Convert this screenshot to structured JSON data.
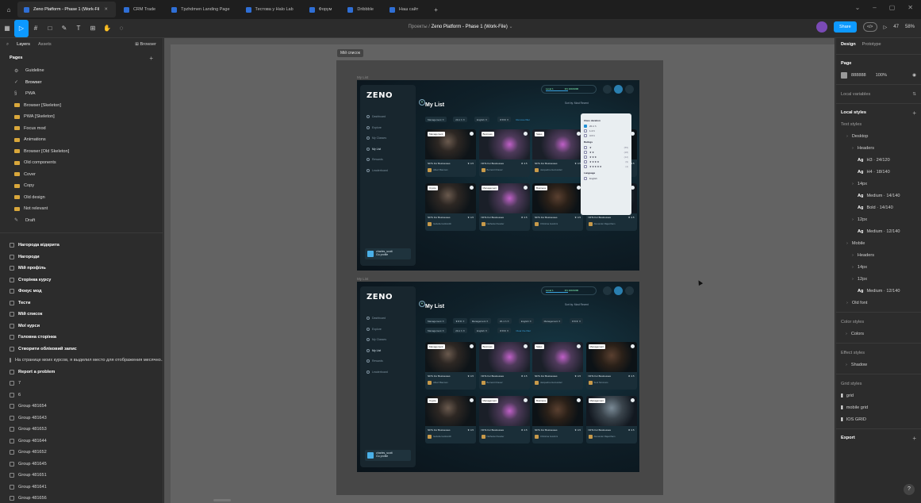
{
  "tabs": [
    {
      "label": "Zeno Platform - Phase 1 (Work-Fil",
      "active": true
    },
    {
      "label": "CRM Trade",
      "active": false
    },
    {
      "label": "Tpzhdmen Landing Page",
      "active": false
    },
    {
      "label": "Тестова у Halo Lab",
      "active": false
    },
    {
      "label": "Форум",
      "active": false
    },
    {
      "label": "Dribbble",
      "active": false
    },
    {
      "label": "Наш сайт",
      "active": false
    }
  ],
  "toolbar": {
    "breadcrumb_parent": "Проекты",
    "breadcrumb_sep": "/",
    "breadcrumb_file": "Zeno Platform - Phase 1 (Work-File)",
    "share_label": "Share",
    "zoom": "58%",
    "dev_mode": "</>",
    "play_label": "▷",
    "user_label": "47"
  },
  "left": {
    "tab_layers": "Layers",
    "tab_assets": "Assets",
    "browse_label": "Browser",
    "pages_heading": "Pages",
    "pages": [
      {
        "label": "Guideline",
        "type": "gear"
      },
      {
        "label": "Browser",
        "type": "check"
      },
      {
        "label": "PWA",
        "type": "plain"
      },
      {
        "label": "Browser [Skeleton]",
        "type": "folder"
      },
      {
        "label": "PWA [Skeleton]",
        "type": "folder"
      },
      {
        "label": "Focus mod",
        "type": "folder"
      },
      {
        "label": "Animations",
        "type": "folder"
      },
      {
        "label": "Browser [Old Skeleton]",
        "type": "folder"
      },
      {
        "label": "Old components",
        "type": "folder"
      },
      {
        "label": "Cover",
        "type": "folder"
      },
      {
        "label": "Copy",
        "type": "folder"
      },
      {
        "label": "Old design",
        "type": "folder"
      },
      {
        "label": "Not relevant",
        "type": "folder"
      },
      {
        "label": "Draft",
        "type": "draft"
      }
    ],
    "layers": [
      {
        "label": "Нагорода відкрита",
        "bold": true
      },
      {
        "label": "Нагороди",
        "bold": true
      },
      {
        "label": "Мій профіль",
        "bold": true
      },
      {
        "label": "Сторінка курсу",
        "bold": true
      },
      {
        "label": "Фокус мод",
        "bold": true
      },
      {
        "label": "Тести",
        "bold": true
      },
      {
        "label": "Мій список",
        "bold": true
      },
      {
        "label": "Мої курси",
        "bold": true
      },
      {
        "label": "Головна сторінка",
        "bold": true
      },
      {
        "label": "Створити обліковий запис",
        "bold": true
      },
      {
        "label": "На странице моих курсов, я выделил место для отображения месячно...",
        "bold": false
      },
      {
        "label": "Report a problem",
        "bold": true
      },
      {
        "label": "7",
        "bold": false
      },
      {
        "label": "6",
        "bold": false
      },
      {
        "label": "Group 481654",
        "bold": false
      },
      {
        "label": "Group 481643",
        "bold": false
      },
      {
        "label": "Group 481653",
        "bold": false
      },
      {
        "label": "Group 481644",
        "bold": false
      },
      {
        "label": "Group 481652",
        "bold": false
      },
      {
        "label": "Group 481645",
        "bold": false
      },
      {
        "label": "Group 481651",
        "bold": false
      },
      {
        "label": "Group 481641",
        "bold": false
      },
      {
        "label": "Group 481656",
        "bold": false
      }
    ]
  },
  "canvas": {
    "frame_label": "Мій список",
    "section_label": "My List",
    "app": {
      "logo": "ZENO",
      "page_title": "My List",
      "nav": [
        "Dashboard",
        "Explore",
        "My Classes",
        "My List",
        "Rewards",
        "Leaderboard"
      ],
      "active_nav": "My List",
      "user_name": "charles_scott",
      "user_sub": "Go profile",
      "level_label": "Level 1",
      "level_xp": "0/1 100/1000",
      "sort_label": "Sort by: Most Recent",
      "chips_1": [
        "Management ✕",
        "20-1 h ✕",
        "English ✕",
        "★★★ ✕"
      ],
      "chips_2": [
        "Management ✕",
        "★★★ ✕",
        "Management ✕",
        "20-1 h ✕",
        "English ✕",
        "Management ✕",
        "★★★ ✕"
      ],
      "chips_2b": [
        "Management ✕",
        "20-1 h ✕",
        "English ✕",
        "★★★ ✕"
      ],
      "remove_filter": "Remove filter",
      "clear_filter": "Clear the filter",
      "cards": [
        {
          "tag": "Management",
          "title": "NFTs For Businesses",
          "rating": "★ 4.5",
          "author": "Albert Bauman",
          "pic": "p1"
        },
        {
          "tag": "Business",
          "title": "NFTs For Businesses",
          "rating": "★ 4.5",
          "author": "Bernard Chavez",
          "pic": "p2"
        },
        {
          "tag": "Sales",
          "title": "NFTs For Businesses",
          "rating": "★ 4.5",
          "author": "Jacqueline Hernandez",
          "pic": "p2"
        },
        {
          "tag": "Management",
          "title": "NFTs For Businesses",
          "rating": "★ 4.5",
          "author": "Soul Simmons",
          "pic": "p3"
        },
        {
          "tag": "Crypto",
          "title": "NFTs For Businesses",
          "rating": "★ 4.5",
          "author": "Isabella Goldsmith",
          "pic": "p1"
        },
        {
          "tag": "Management",
          "title": "NFTs For Businesses",
          "rating": "★ 4.5",
          "author": "Nathaniel Kessler",
          "pic": "p2"
        },
        {
          "tag": "Business",
          "title": "NFTs For Businesses",
          "rating": "★ 4.5",
          "author": "Christina Gustinni",
          "pic": "p3"
        },
        {
          "tag": "Management",
          "title": "NFTs For Businesses",
          "rating": "★ 4.5",
          "author": "Alexander Rajentham",
          "pic": "p4"
        }
      ],
      "filter": {
        "duration_heading": "Class duration",
        "durations": [
          {
            "label": "20-1 h",
            "on": true
          },
          {
            "label": "1-3 h",
            "on": false
          },
          {
            "label": "3-5 h",
            "on": false
          }
        ],
        "ratings_heading": "Ratings",
        "ratings": [
          {
            "stars": "★",
            "count": "(55)"
          },
          {
            "stars": "★★",
            "count": "(28)"
          },
          {
            "stars": "★★★",
            "count": "(12)"
          },
          {
            "stars": "★★★★",
            "count": "(9)"
          },
          {
            "stars": "★★★★★",
            "count": "(4)"
          }
        ],
        "language_heading": "Language",
        "languages": [
          {
            "label": "English",
            "on": false
          }
        ]
      }
    }
  },
  "right": {
    "tab_design": "Design",
    "tab_prototype": "Prototype",
    "page_heading": "Page",
    "page_color": "888888",
    "page_opacity": "100%",
    "local_variables": "Local variables",
    "local_styles": "Local styles",
    "text_styles": "Text styles",
    "text_items": [
      {
        "label": "Desktop",
        "kind": "group",
        "indent": 1
      },
      {
        "label": "Headers",
        "kind": "group",
        "indent": 2
      },
      {
        "label": "H3 · 24/120",
        "kind": "ag",
        "indent": 3
      },
      {
        "label": "H4 · 18/140",
        "kind": "ag",
        "indent": 3
      },
      {
        "label": "14px",
        "kind": "group",
        "indent": 2
      },
      {
        "label": "Medium · 14/140",
        "kind": "ag",
        "indent": 3
      },
      {
        "label": "Bold · 14/140",
        "kind": "ag",
        "indent": 3
      },
      {
        "label": "12px",
        "kind": "group",
        "indent": 2
      },
      {
        "label": "Medium · 12/140",
        "kind": "ag",
        "indent": 3
      },
      {
        "label": "Mobile",
        "kind": "group",
        "indent": 1
      },
      {
        "label": "Headers",
        "kind": "group",
        "indent": 2
      },
      {
        "label": "14px",
        "kind": "group",
        "indent": 2
      },
      {
        "label": "12px",
        "kind": "group",
        "indent": 2
      },
      {
        "label": "Medium · 12/140",
        "kind": "ag",
        "indent": 3
      },
      {
        "label": "Old font",
        "kind": "group",
        "indent": 1
      }
    ],
    "color_styles": "Color styles",
    "colors_item": "Colors",
    "effect_styles": "Effect styles",
    "shadow_item": "Shadow",
    "grid_styles": "Grid styles",
    "grid_items": [
      "grid",
      "mobile grid",
      "IOS GRID"
    ],
    "export_label": "Export",
    "help": "?"
  }
}
